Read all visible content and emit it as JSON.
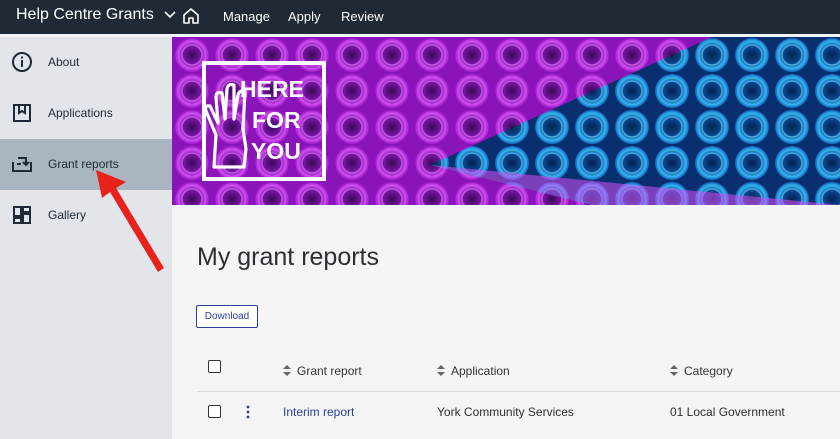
{
  "topbar": {
    "brand": "Help Centre Grants",
    "nav": {
      "manage": "Manage",
      "apply": "Apply",
      "review": "Review"
    }
  },
  "sidebar": {
    "items": [
      {
        "label": "About",
        "icon": "info-icon"
      },
      {
        "label": "Applications",
        "icon": "bookmark-icon"
      },
      {
        "label": "Grant reports",
        "icon": "tray-arrow-icon",
        "active": true
      },
      {
        "label": "Gallery",
        "icon": "dashboard-icon"
      }
    ]
  },
  "banner": {
    "logo_lines": [
      "HERE",
      "FOR",
      "YOU"
    ]
  },
  "main": {
    "title": "My grant reports",
    "download_label": "Download",
    "table": {
      "headers": [
        "Grant report",
        "Application",
        "Category"
      ],
      "rows": [
        {
          "grant_report": "Interim report",
          "application": "York Community Services",
          "category": "01 Local Government"
        }
      ]
    }
  },
  "colors": {
    "topbar": "#1f2a36",
    "active_nav": "#a9b6c2",
    "link": "#2c3e9c",
    "arrow": "#e8211a"
  }
}
